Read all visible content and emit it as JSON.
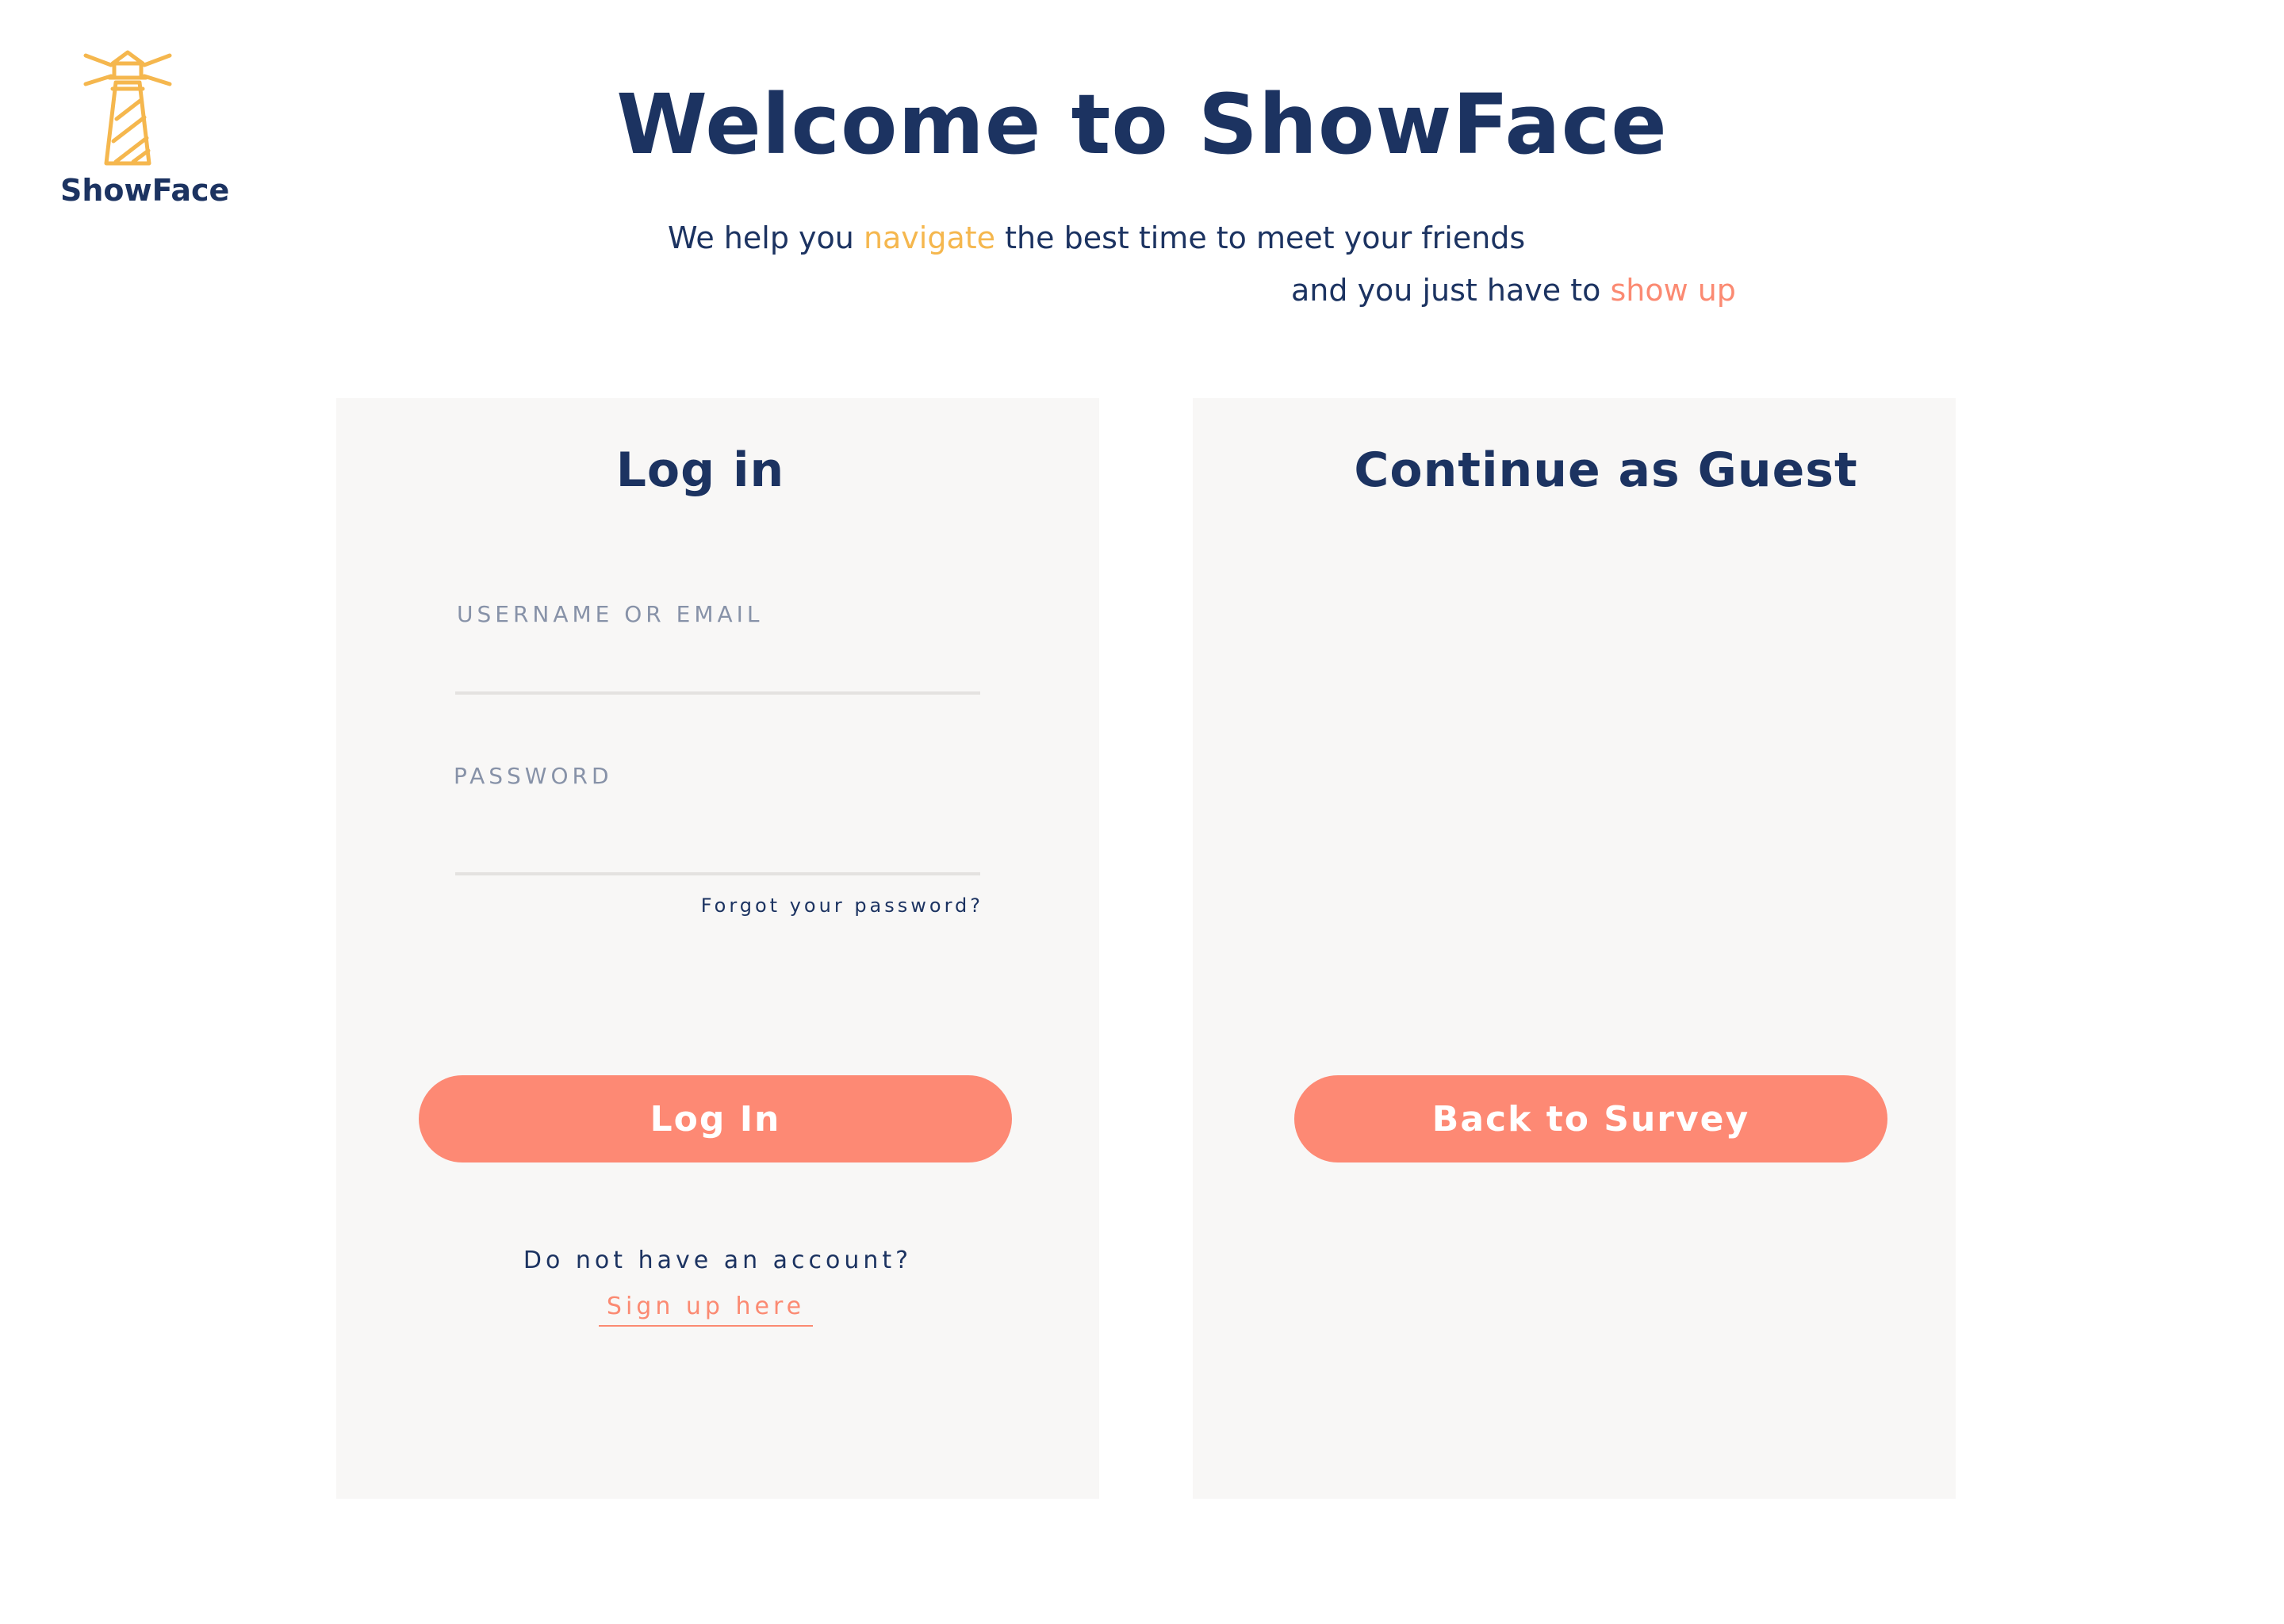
{
  "brand": {
    "name": "ShowFace",
    "logo_icon": "lighthouse-icon",
    "logo_color": "#f5b74e"
  },
  "header": {
    "title": "Welcome to ShowFace",
    "tagline_line1": {
      "before": "We help you ",
      "highlight": "navigate",
      "after": " the best time to meet your friends"
    },
    "tagline_line2": {
      "before": "and you just have to ",
      "highlight": "show up"
    }
  },
  "login_panel": {
    "title": "Log in",
    "username_label": "USERNAME OR EMAIL",
    "username_value": "",
    "password_label": "PASSWORD",
    "password_value": "",
    "forgot_link": "Forgot your password?",
    "submit_label": "Log In",
    "no_account_text": "Do not have an account?",
    "signup_link": "Sign up here"
  },
  "guest_panel": {
    "title": "Continue as Guest",
    "back_label": "Back to Survey"
  },
  "colors": {
    "navy": "#1c3361",
    "coral": "#fd8974",
    "yellow": "#f5b74e",
    "panel_bg": "#f8f7f6"
  }
}
